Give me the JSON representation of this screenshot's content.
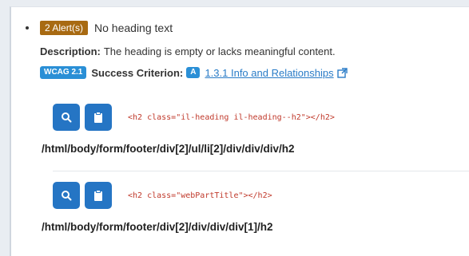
{
  "alert": {
    "badge": "2 Alert(s)",
    "title": "No heading text"
  },
  "description": {
    "label": "Description:",
    "text": "The heading is empty or lacks meaningful content."
  },
  "criterion": {
    "wcag_badge": "WCAG 2.1",
    "label": "Success Criterion:",
    "level": "A",
    "link": "1.3.1 Info and Relationships"
  },
  "occurrences": [
    {
      "code": "<h2 class=\"il-heading il-heading--h2\"></h2>",
      "xpath": "/html/body/form/footer/div[2]/ul/li[2]/div/div/div/h2"
    },
    {
      "code": "<h2 class=\"webPartTitle\"></h2>",
      "xpath": "/html/body/form/footer/div[2]/div/div/div[1]/h2"
    }
  ],
  "icons": {
    "search": "search-icon",
    "clipboard": "clipboard-icon",
    "external": "external-link-icon"
  },
  "colors": {
    "alert_badge": "#a86a12",
    "wcag_badge": "#2a8fd6",
    "button": "#2575c4",
    "link": "#2a7cc7",
    "code": "#c0392b"
  }
}
